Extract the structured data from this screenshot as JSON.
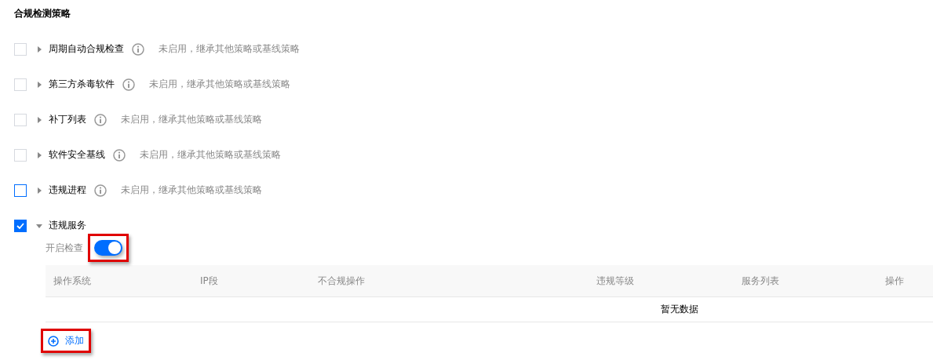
{
  "title": "合规检测策略",
  "policies": [
    {
      "label": "周期自动合规检查",
      "checked": false,
      "focused": false,
      "expanded": false,
      "hint": "未启用，继承其他策略或基线策略"
    },
    {
      "label": "第三方杀毒软件",
      "checked": false,
      "focused": false,
      "expanded": false,
      "hint": "未启用，继承其他策略或基线策略"
    },
    {
      "label": "补丁列表",
      "checked": false,
      "focused": false,
      "expanded": false,
      "hint": "未启用，继承其他策略或基线策略"
    },
    {
      "label": "软件安全基线",
      "checked": false,
      "focused": false,
      "expanded": false,
      "hint": "未启用，继承其他策略或基线策略"
    },
    {
      "label": "违规进程",
      "checked": false,
      "focused": true,
      "expanded": false,
      "hint": "未启用，继承其他策略或基线策略"
    },
    {
      "label": "违规服务",
      "checked": true,
      "focused": false,
      "expanded": true
    }
  ],
  "detail": {
    "toggle_label": "开启检查",
    "toggle_on": true,
    "toggle_highlighted": true,
    "table": {
      "columns": [
        "操作系统",
        "IP段",
        "不合规操作",
        "违规等级",
        "服务列表",
        "操作"
      ],
      "empty_text": "暂无数据"
    },
    "add_button": {
      "label": "添加",
      "highlighted": true
    }
  }
}
